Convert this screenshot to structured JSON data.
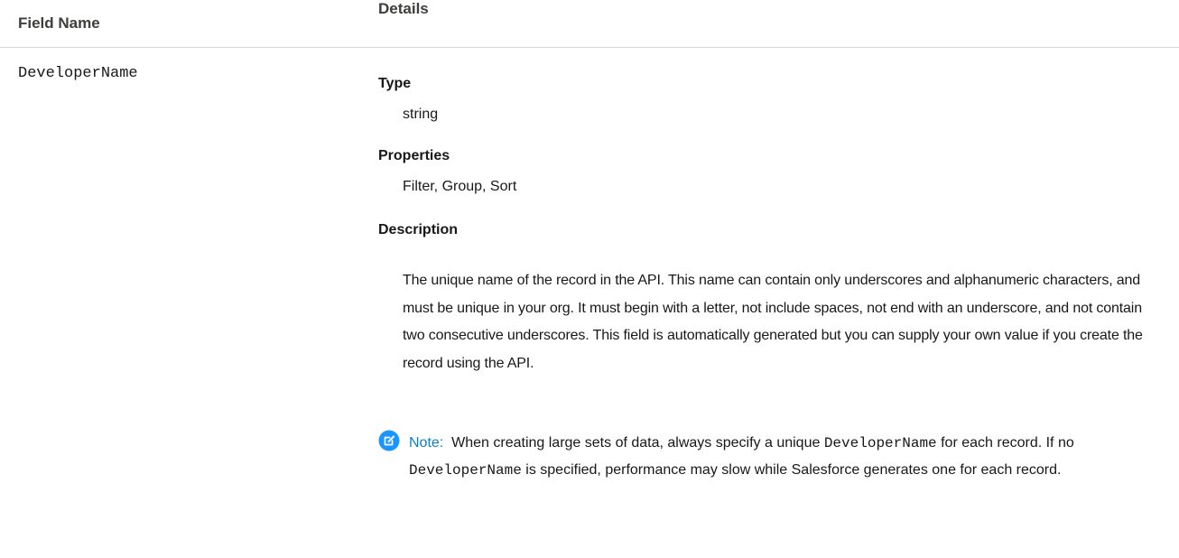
{
  "header": {
    "field_name": "Field Name",
    "details": "Details"
  },
  "row": {
    "field_name": "DeveloperName",
    "type_label": "Type",
    "type_value": "string",
    "properties_label": "Properties",
    "properties_value": "Filter, Group, Sort",
    "description_label": "Description",
    "description": "The unique name of the record in the API. This name can contain only underscores and alphanumeric characters, and must be unique in your org. It must begin with a letter, not include spaces, not end with an underscore, and not contain two consecutive underscores. This field is automatically generated but you can supply your own value if you create the record using the API.",
    "note": {
      "icon": "note-edit-icon",
      "icon_color": "#1b96ff",
      "label": "Note:",
      "text_1": "When creating large sets of data, always specify a unique",
      "code_1": "DeveloperName",
      "text_2": "for each record. If no",
      "code_2": "DeveloperName",
      "text_3": "is specified, performance may slow while Salesforce generates one for each record."
    }
  }
}
